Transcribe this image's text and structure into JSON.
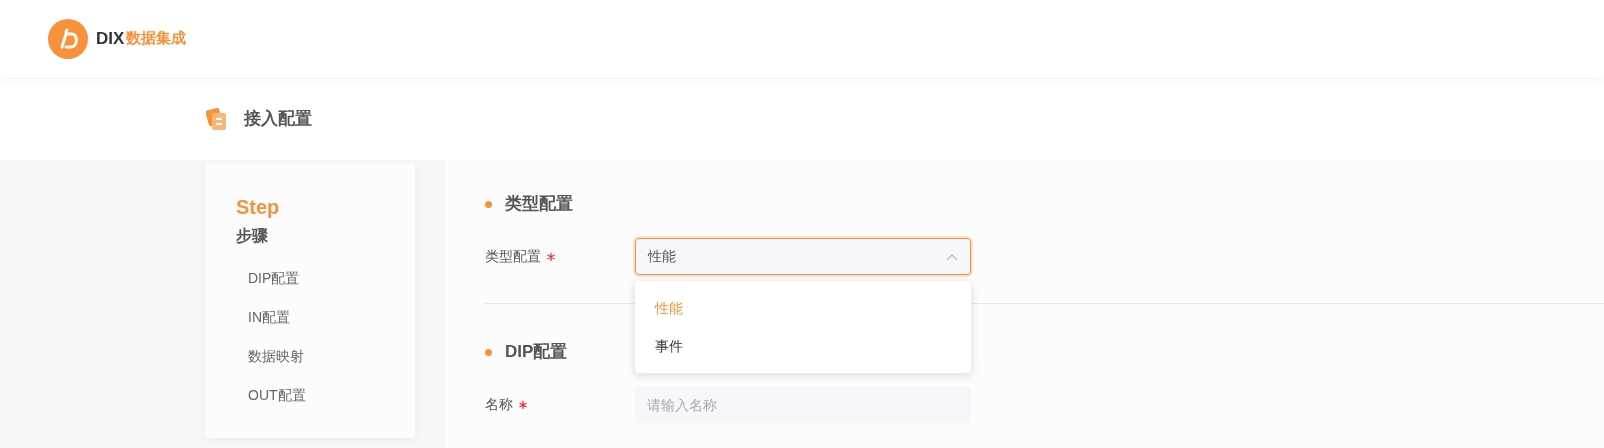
{
  "header": {
    "logo_text": "DIX",
    "logo_subtitle": "数据集成"
  },
  "page_title": "接入配置",
  "steps": {
    "title": "Step",
    "subtitle": "步骤",
    "items": [
      {
        "label": "DIP配置"
      },
      {
        "label": "IN配置"
      },
      {
        "label": "数据映射"
      },
      {
        "label": "OUT配置"
      }
    ]
  },
  "sections": [
    {
      "title": "类型配置",
      "fields": [
        {
          "kind": "select",
          "label": "类型配置",
          "required": true,
          "value": "性能",
          "expanded": true,
          "options": [
            {
              "label": "性能",
              "selected": true
            },
            {
              "label": "事件",
              "selected": false
            }
          ]
        }
      ]
    },
    {
      "title": "DIP配置",
      "fields": [
        {
          "kind": "input",
          "label": "名称",
          "required": true,
          "placeholder": "请输入名称"
        }
      ]
    }
  ]
}
